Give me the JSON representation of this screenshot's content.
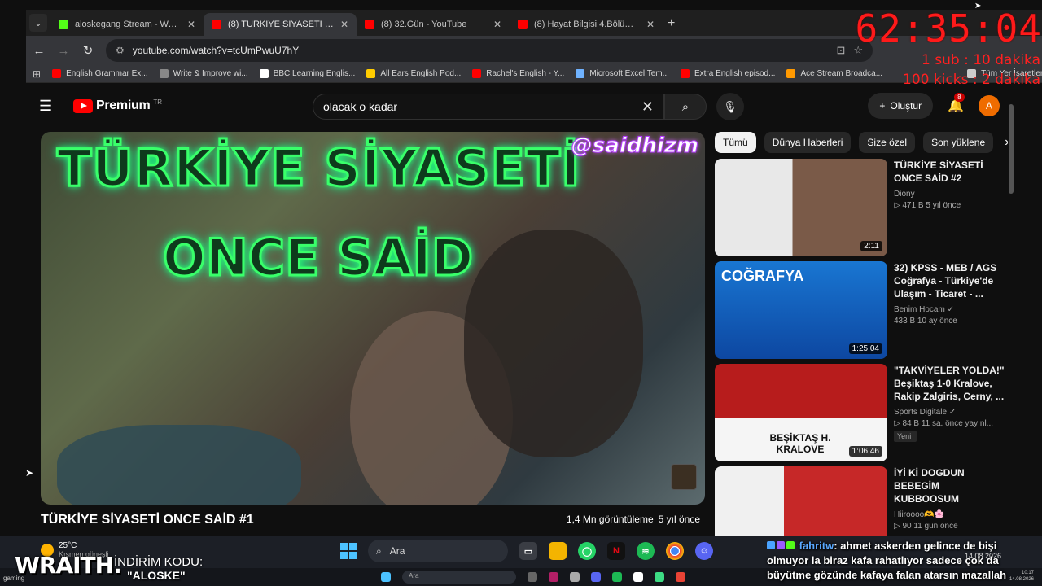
{
  "browser": {
    "tabs": [
      {
        "title": "aloskegang Stream - Watch Live",
        "color": "#53fc18",
        "icon": "kick-icon"
      },
      {
        "title": "(8) TÜRKİYE SİYASETİ ONCE SAİD",
        "color": "#ff0000",
        "icon": "youtube-icon",
        "active": true
      },
      {
        "title": "(8) 32.Gün - YouTube",
        "color": "#ff0000",
        "icon": "youtube-icon"
      },
      {
        "title": "(8) Hayat Bilgisi 4.Bölüm - FULL",
        "color": "#ff0000",
        "icon": "youtube-icon"
      }
    ],
    "new_tab": "+",
    "url": "youtube.com/watch?v=tcUmPwuU7hY",
    "bookmarks": [
      {
        "label": "English Grammar Ex...",
        "color": "#ff0000"
      },
      {
        "label": "Write & Improve wi...",
        "color": "#888888"
      },
      {
        "label": "BBC Learning Englis...",
        "color": "#ffffff"
      },
      {
        "label": "All Ears English Pod...",
        "color": "#ffcc00"
      },
      {
        "label": "Rachel's English - Y...",
        "color": "#ff0000"
      },
      {
        "label": "Microsoft Excel Tem...",
        "color": "#6fb2ff"
      },
      {
        "label": "Extra English episod...",
        "color": "#ff0000"
      },
      {
        "label": "Ace Stream Broadca...",
        "color": "#ff9900"
      },
      {
        "label": "Tüm Yer İşaretleri",
        "color": "#cccccc"
      }
    ]
  },
  "overlay": {
    "timer": "62:35:04",
    "sub_rule": "1 sub : 10 dakika",
    "kicks_rule": "100 kicks : 2 dakika",
    "brand": "WRAITH.",
    "promo_label": "İNDİRİM KODU:",
    "promo_code": "\"ALOSKE\"",
    "tiny_user": "gaming"
  },
  "youtube": {
    "logo_text": "Premium",
    "logo_region": "TR",
    "search_query": "olacak o kadar",
    "create_label": "Oluştur",
    "notif_count": "8",
    "avatar_letter": "A",
    "video": {
      "overlay_line1": "TÜRKİYE SİYASETİ",
      "overlay_line2": "ONCE SAİD",
      "handle": "@saidhizm",
      "title": "TÜRKİYE SİYASETİ ONCE SAİD #1",
      "views": "1,4 Mn görüntüleme",
      "age": "5 yıl önce"
    },
    "chips": [
      "Tümü",
      "Dünya Haberleri",
      "Size özel",
      "Son yüklene"
    ],
    "recommendations": [
      {
        "title": "TÜRKİYE SİYASETİ ONCE SAİD #2",
        "channel": "Diony",
        "stats": "▷ 471 B   5 yıl önce",
        "duration": "2:11",
        "bg": "#8a6c5a",
        "thumb_text": ""
      },
      {
        "title": "32) KPSS - MEB / AGS Coğrafya - Türkiye'de Ulaşım - Ticaret - ...",
        "channel": "Benim Hocam",
        "stats": "433 B   10 ay önce",
        "duration": "1:25:04",
        "bg": "#1565c0",
        "thumb_text": "COĞRAFYA"
      },
      {
        "title": "\"TAKVİYELER YOLDA!\" Beşiktaş 1-0 Kralove, Rakip Zalgiris, Cerny, ...",
        "channel": "Sports Digitale",
        "stats": "▷ 84 B   11 sa. önce yayınl...",
        "duration": "1:06:46",
        "bg": "#c62828",
        "thumb_text": "BEŞİKTAŞ H. KRALOVE",
        "badge": "Yeni"
      },
      {
        "title": "İYİ Kİ DOGDUN BEBEGİM KUBBOOSUM",
        "channel": "Hiiroooo🫶🌸",
        "stats": "▷ 90   11 gün önce",
        "duration": "",
        "bg": "#d32f2f",
        "thumb_text": ""
      }
    ]
  },
  "taskbar": {
    "temp": "25°C",
    "condition": "Kısmen güneşli",
    "search_label": "Ara",
    "bottom_search": "Ara",
    "clock_time": "10:17",
    "clock_date": "14.08.2026",
    "top_clock_date": "14.08.2026"
  },
  "chat": {
    "username": "fahritw",
    "message": ": ahmet askerden gelince de bişi olmuyor la biraz kafa rahatlıyor sadece çok da büyütme gözünde kafaya falan atarsın mazallah"
  }
}
